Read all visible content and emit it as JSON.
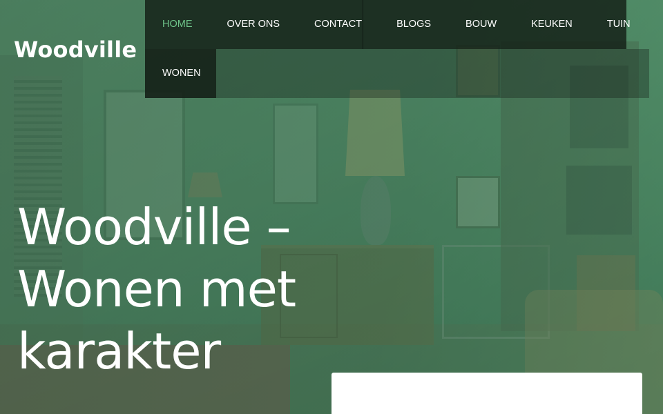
{
  "site": {
    "title": "Woodville"
  },
  "nav": {
    "items": [
      {
        "label": "HOME",
        "active": true
      },
      {
        "label": "OVER ONS",
        "active": false
      },
      {
        "label": "CONTACT",
        "active": false
      },
      {
        "label": "BLOGS",
        "active": false
      },
      {
        "label": "BOUW",
        "active": false
      },
      {
        "label": "KEUKEN",
        "active": false
      },
      {
        "label": "TUIN",
        "active": false
      },
      {
        "label": "WONEN",
        "active": false
      }
    ],
    "active_color": "#6fc48a"
  },
  "hero": {
    "heading": "Woodville – Wonen met karakter",
    "overlay_color": "#4a8a62"
  }
}
